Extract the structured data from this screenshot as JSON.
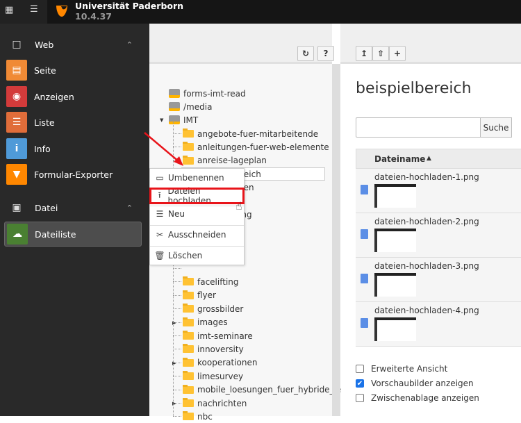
{
  "topbar": {
    "site_name": "Universität Paderborn",
    "version": "10.4.37",
    "logo": "typo3-logo"
  },
  "sidebar": {
    "groups": [
      {
        "label": "Web",
        "icon": "page-icon"
      },
      {
        "label": "Datei",
        "icon": "image-icon"
      }
    ],
    "web_items": [
      {
        "label": "Seite",
        "color": "#f08a35"
      },
      {
        "label": "Anzeigen",
        "color": "#d33b3b"
      },
      {
        "label": "Liste",
        "color": "#e06d3a"
      },
      {
        "label": "Info",
        "color": "#4f9ad8"
      },
      {
        "label": "Formular-Exporter",
        "color": "#ff8700"
      }
    ],
    "file_items": [
      {
        "label": "Dateiliste",
        "color": "#4a8032",
        "active": true
      }
    ]
  },
  "tree": {
    "toolbar": {
      "refresh": "refresh-icon",
      "help": "?"
    },
    "roots": [
      {
        "label": "forms-imt-read"
      },
      {
        "label": "/media"
      },
      {
        "label": "IMT"
      }
    ],
    "children": [
      "angebote-fuer-mitarbeitende",
      "anleitungen-fuer-web-elemente",
      "anreise-lageplan",
      "beispielbereich",
      "lien",
      "",
      "ing",
      "",
      "",
      "",
      "",
      "facelifting",
      "flyer",
      "grossbilder",
      "images",
      "imt-seminare",
      "innoversity",
      "kooperationen",
      "limesurvey",
      "mobile_loesungen_fuer_hybride_le",
      "nachrichten",
      "nbc"
    ]
  },
  "context_menu": {
    "items": [
      {
        "label": "Umbenennen",
        "icon": "rename-icon"
      },
      {
        "label": "Dateien hochladen",
        "icon": "upload-icon",
        "highlighted": true
      },
      {
        "label": "Neu",
        "icon": "new-icon"
      },
      {
        "label": "Ausschneiden",
        "icon": "scissors-icon"
      },
      {
        "label": "Löschen",
        "icon": "trash-icon"
      }
    ]
  },
  "main": {
    "title": "beispielbereich",
    "search": {
      "value": "",
      "button": "Suche"
    },
    "table": {
      "column": "Dateiname",
      "sort": "ascending",
      "files": [
        "dateien-hochladen-1.png",
        "dateien-hochladen-2.png",
        "dateien-hochladen-3.png",
        "dateien-hochladen-4.png"
      ]
    },
    "options": [
      {
        "label": "Erweiterte Ansicht",
        "checked": false
      },
      {
        "label": "Vorschaubilder anzeigen",
        "checked": true
      },
      {
        "label": "Zwischenablage anzeigen",
        "checked": false
      }
    ]
  },
  "colors": {
    "highlight": "#e8141a",
    "annotation_arrow": "#e8141a",
    "accent": "#ff8700"
  }
}
